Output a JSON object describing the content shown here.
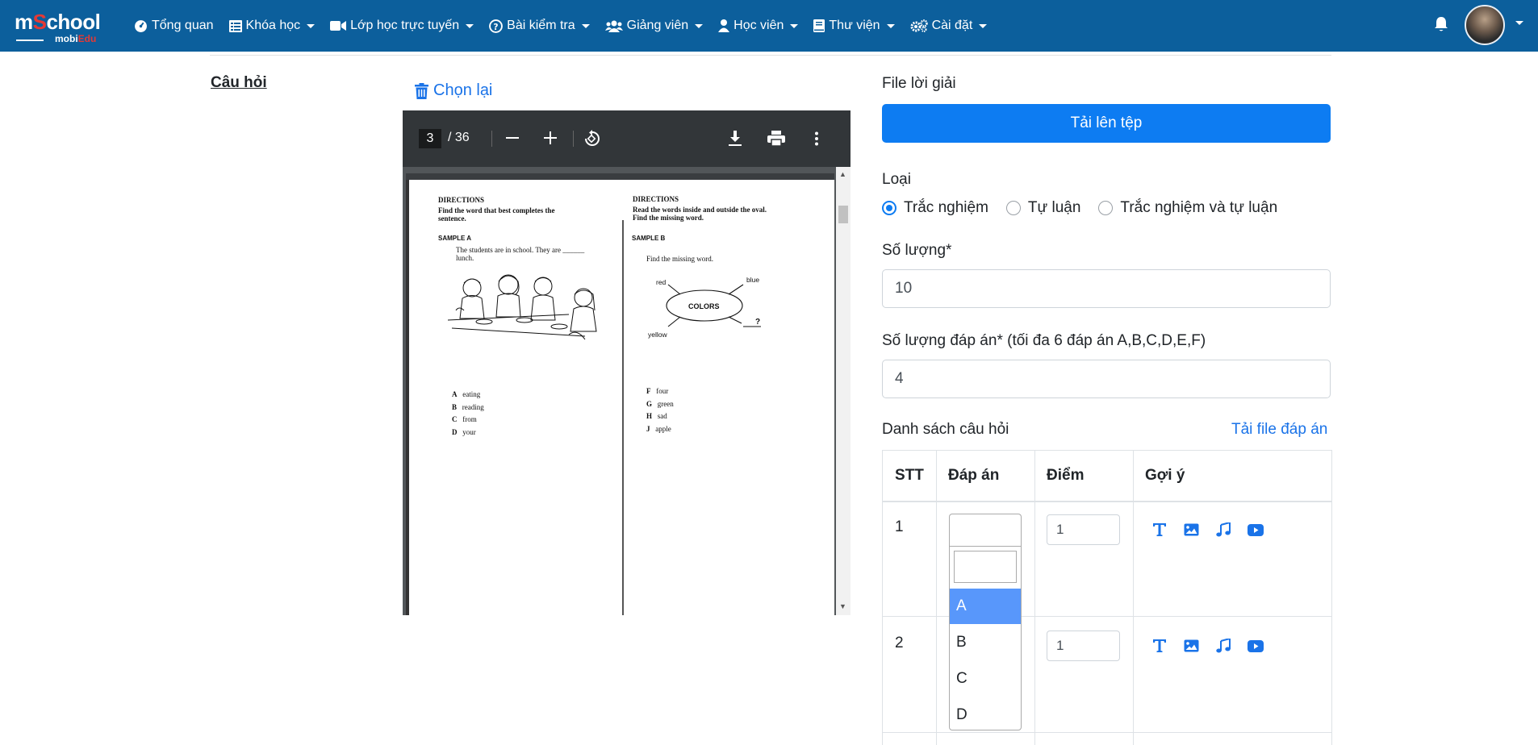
{
  "brand": {
    "logo_main_pre": "m",
    "logo_main_o": "S",
    "logo_main_post": "chool",
    "logo_sub_pre": "mobi",
    "logo_sub_post": "Edu"
  },
  "nav": [
    {
      "label": "Tổng quan",
      "icon": "dashboard-icon",
      "dropdown": false
    },
    {
      "label": "Khóa học",
      "icon": "list-icon",
      "dropdown": true
    },
    {
      "label": "Lớp học trực tuyến",
      "icon": "video-icon",
      "dropdown": true
    },
    {
      "label": "Bài kiểm tra",
      "icon": "question-circle-icon",
      "dropdown": true
    },
    {
      "label": "Giảng viên",
      "icon": "users-icon",
      "dropdown": true
    },
    {
      "label": "Học viên",
      "icon": "user-icon",
      "dropdown": true
    },
    {
      "label": "Thư viện",
      "icon": "book-icon",
      "dropdown": true
    },
    {
      "label": "Cài đặt",
      "icon": "cogs-icon",
      "dropdown": true
    }
  ],
  "left": {
    "title": "Câu hỏi"
  },
  "pdf": {
    "reset_label": "Chọn lại",
    "page_current": "3",
    "page_total": "/ 36",
    "left_col": {
      "directions": "DIRECTIONS",
      "instr_1": "Find the word that best completes the",
      "instr_2": "sentence.",
      "sample": "SAMPLE A",
      "sentence_1": "The students are in school. They are ______",
      "sentence_2": "lunch.",
      "options": [
        [
          "A",
          "eating"
        ],
        [
          "B",
          "reading"
        ],
        [
          "C",
          "from"
        ],
        [
          "D",
          "your"
        ]
      ]
    },
    "right_col": {
      "directions": "DIRECTIONS",
      "instr_1": "Read the words inside and outside the oval.",
      "instr_2": "Find the missing word.",
      "sample": "SAMPLE B",
      "prompt": "Find the missing word.",
      "oval_label": "COLORS",
      "words": {
        "red": "red",
        "blue": "blue",
        "yellow": "yellow",
        "missing": "?"
      },
      "options": [
        [
          "F",
          "four"
        ],
        [
          "G",
          "green"
        ],
        [
          "H",
          "sad"
        ],
        [
          "J",
          "apple"
        ]
      ]
    }
  },
  "form": {
    "file_label": "File lời giải",
    "upload_button": "Tải lên tệp",
    "type_label": "Loại",
    "types": [
      "Trắc nghiệm",
      "Tự luận",
      "Trắc nghiệm và tự luận"
    ],
    "type_selected": 0,
    "count_label": "Số lượng*",
    "count_value": "10",
    "answers_label": "Số lượng đáp án* (tối đa 6 đáp án A,B,C,D,E,F)",
    "answers_value": "4",
    "list_label": "Danh sách câu hỏi",
    "download_link": "Tải file đáp án"
  },
  "table": {
    "headers": [
      "STT",
      "Đáp án",
      "Điểm",
      "Gợi ý"
    ],
    "rows": [
      {
        "stt": "1",
        "diem": "1"
      },
      {
        "stt": "2",
        "diem": "1"
      }
    ],
    "hint_icons": [
      "text-icon",
      "image-icon",
      "music-icon",
      "youtube-icon"
    ],
    "dropdown_options": [
      "A",
      "B",
      "C",
      "D"
    ],
    "dropdown_active": "A"
  },
  "colors": {
    "navbar": "#0c5f9c",
    "primary": "#0d7cf2",
    "link": "#1a73e8",
    "dropdown_active": "#5897fb"
  }
}
